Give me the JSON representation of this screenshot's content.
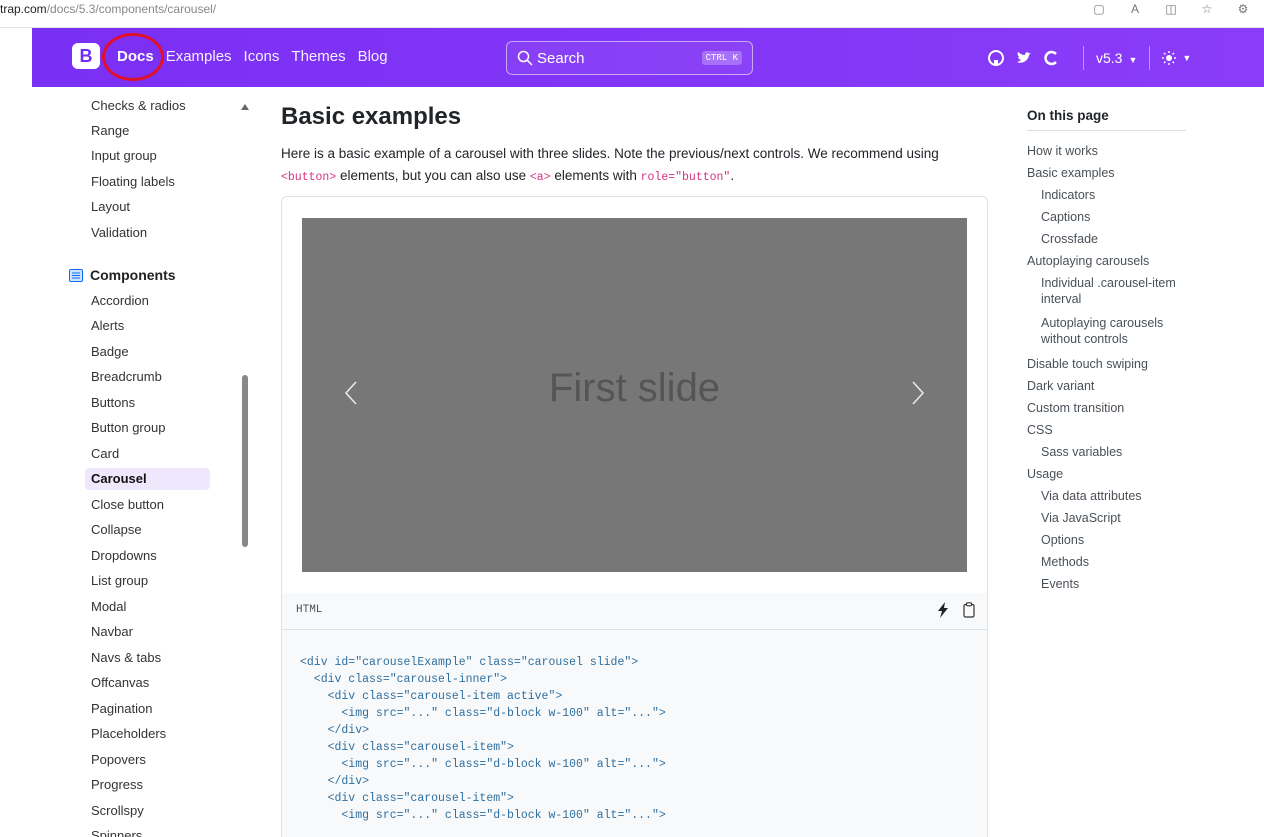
{
  "browser": {
    "url_host": "trap.com",
    "url_path": "/docs/5.3/components/carousel/"
  },
  "navbar": {
    "brand": "B",
    "links": [
      {
        "label": "Docs",
        "active": true
      },
      {
        "label": "Examples",
        "active": false
      },
      {
        "label": "Icons",
        "active": false
      },
      {
        "label": "Themes",
        "active": false
      },
      {
        "label": "Blog",
        "active": false
      }
    ],
    "search_label": "Search",
    "search_shortcut": "CTRL K",
    "version": "v5.3",
    "accent_color": "#712cf9",
    "annotation_color": "#e0102a"
  },
  "sidebar": {
    "forms_items": [
      "Checks & radios",
      "Range",
      "Input group",
      "Floating labels",
      "Layout",
      "Validation"
    ],
    "components_heading": "Components",
    "component_items": [
      "Accordion",
      "Alerts",
      "Badge",
      "Breadcrumb",
      "Buttons",
      "Button group",
      "Card",
      "Carousel",
      "Close button",
      "Collapse",
      "Dropdowns",
      "List group",
      "Modal",
      "Navbar",
      "Navs & tabs",
      "Offcanvas",
      "Pagination",
      "Placeholders",
      "Popovers",
      "Progress",
      "Scrollspy",
      "Spinners"
    ],
    "active_item": "Carousel"
  },
  "main": {
    "title": "Basic examples",
    "desc_part1": "Here is a basic example of a carousel with three slides. Note the previous/next controls. We recommend using",
    "code_button": "<button>",
    "desc_part2": " elements, but you can also use ",
    "code_a": "<a>",
    "desc_part3": " elements with ",
    "code_role": "role=\"button\"",
    "desc_part4": ".",
    "slide_label": "First slide",
    "code_lang": "HTML",
    "code_lines": [
      "<div id=\"carouselExample\" class=\"carousel slide\">",
      "  <div class=\"carousel-inner\">",
      "    <div class=\"carousel-item active\">",
      "      <img src=\"...\" class=\"d-block w-100\" alt=\"...\">",
      "    </div>",
      "    <div class=\"carousel-item\">",
      "      <img src=\"...\" class=\"d-block w-100\" alt=\"...\">",
      "    </div>",
      "    <div class=\"carousel-item\">",
      "      <img src=\"...\" class=\"d-block w-100\" alt=\"...\">"
    ]
  },
  "toc": {
    "title": "On this page",
    "items": [
      {
        "label": "How it works",
        "level": 1
      },
      {
        "label": "Basic examples",
        "level": 1
      },
      {
        "label": "Indicators",
        "level": 2
      },
      {
        "label": "Captions",
        "level": 2
      },
      {
        "label": "Crossfade",
        "level": 2
      },
      {
        "label": "Autoplaying carousels",
        "level": 1
      },
      {
        "label": "Individual .carousel-item interval",
        "level": 2
      },
      {
        "label": "Autoplaying carousels without controls",
        "level": 2
      },
      {
        "label": "Disable touch swiping",
        "level": 1
      },
      {
        "label": "Dark variant",
        "level": 1
      },
      {
        "label": "Custom transition",
        "level": 1
      },
      {
        "label": "CSS",
        "level": 1
      },
      {
        "label": "Sass variables",
        "level": 2
      },
      {
        "label": "Usage",
        "level": 1
      },
      {
        "label": "Via data attributes",
        "level": 2
      },
      {
        "label": "Via JavaScript",
        "level": 2
      },
      {
        "label": "Options",
        "level": 2
      },
      {
        "label": "Methods",
        "level": 2
      },
      {
        "label": "Events",
        "level": 2
      }
    ]
  }
}
